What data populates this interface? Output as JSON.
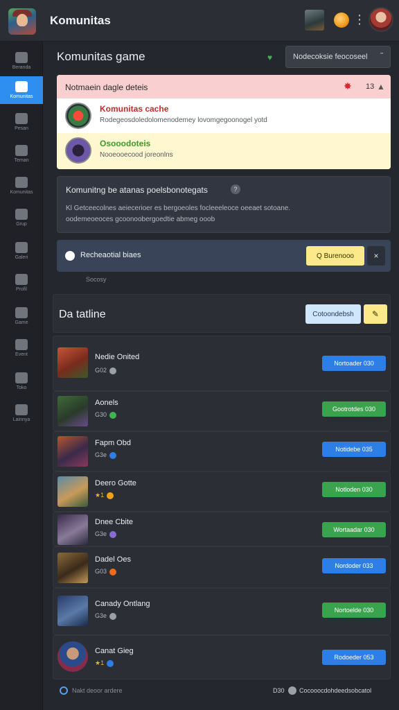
{
  "app": {
    "title": "Komunitas"
  },
  "sidebar": {
    "items": [
      {
        "label": "Beranda",
        "icon": "home-icon"
      },
      {
        "label": "Komunitas",
        "icon": "chat-icon",
        "active": true
      },
      {
        "label": "Pesan",
        "icon": "mail-icon"
      },
      {
        "label": "Teman",
        "icon": "friends-icon"
      },
      {
        "label": "Komunitas",
        "icon": "community-icon"
      },
      {
        "label": "Grup",
        "icon": "group-icon"
      },
      {
        "label": "Galeri",
        "icon": "gallery-icon"
      },
      {
        "label": "Profil",
        "icon": "profile-icon"
      },
      {
        "label": "Game",
        "icon": "gamepad-icon"
      },
      {
        "label": "Event",
        "icon": "event-icon"
      },
      {
        "label": "Toko",
        "icon": "store-icon"
      },
      {
        "label": "Lainnya",
        "icon": "more-icon"
      }
    ]
  },
  "header": {
    "title": "Komunitas game",
    "sort_label": "Nodecoksie feocoseel",
    "sort_chevron": "˜"
  },
  "alert": {
    "title": "Notmaein dagle deteis",
    "count": "13",
    "rows": [
      {
        "title": "Komunitas cache",
        "sub": "Rodegeosdoledolomenodemey lovomgegoonogel yotd"
      },
      {
        "title": "Osooodoteis",
        "sub": "Nooeooecood joreonlns"
      }
    ]
  },
  "info": {
    "title": "Komunitng be atanas poelsbonotegats",
    "line1": "Kl Getceecolnes aeiecerioer es bergoeoles focleeeleoce oeeaet sotoane.",
    "line2": "oodemeoeoces gcoonoobergoedtie abmeg ooob"
  },
  "filter": {
    "label": "Recheaotial biaes",
    "button": "Q Burenooo",
    "close": "×",
    "note": "Socosy"
  },
  "list": {
    "title": "Da tatline",
    "button": "Cotoondebsh",
    "edit": "✎"
  },
  "players": [
    {
      "name": "Nedie Onited",
      "meta": "G02",
      "action": "Nortoader 030",
      "color": "blue"
    },
    {
      "name": "Aonels",
      "meta": "G30",
      "action": "Gootrotdes 030",
      "color": "green"
    },
    {
      "name": "Fapm Obd",
      "meta": "G3e",
      "action": "Notidebe 035",
      "color": "blue"
    },
    {
      "name": "Deero Gotte",
      "meta": "★1",
      "action": "Notloden 030",
      "color": "green"
    },
    {
      "name": "Dnee Cbite",
      "meta": "G3e",
      "action": "Wortaadar 030",
      "color": "green"
    },
    {
      "name": "Dadel Oes",
      "meta": "G03",
      "action": "Nordoder 033",
      "color": "blue"
    },
    {
      "name": "Canady Ontlang",
      "meta": "G3e",
      "action": "Nortoelde 030",
      "color": "green"
    },
    {
      "name": "Canat Gieg",
      "meta": "★1",
      "action": "Rodoeder 053",
      "color": "blue"
    }
  ],
  "footer": {
    "left": "Nakt deoor ardere",
    "right_count": "D30",
    "right_text": "Cocooocdohdeedsobcatol"
  },
  "colors": {
    "accent": "#2f8ff0",
    "success": "#3aa34e",
    "action_blue": "#2d7ee6"
  }
}
